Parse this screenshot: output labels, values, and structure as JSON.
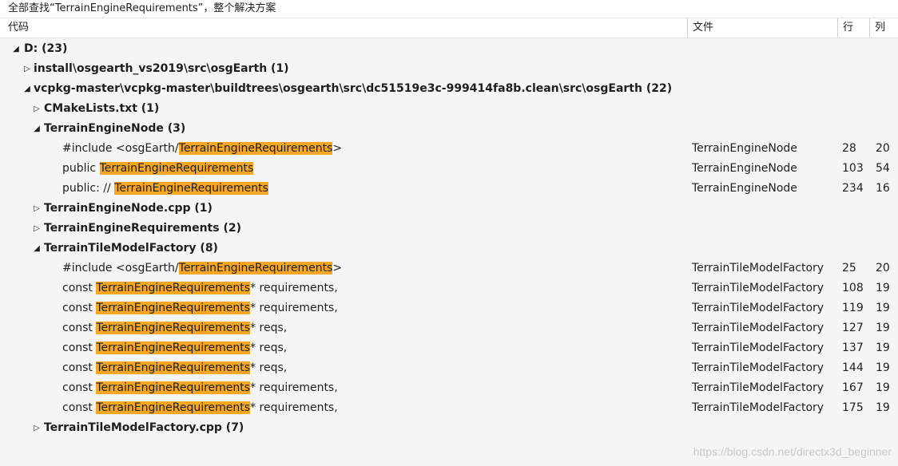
{
  "title": "全部查找“TerrainEngineRequirements”，整个解决方案",
  "columns": {
    "code": "代码",
    "file": "文件",
    "line": "行",
    "col": "列"
  },
  "tree": {
    "root": {
      "label": "D:",
      "count": "(23)"
    },
    "install": {
      "label": "install\\osgearth_vs2019\\src\\osgEarth",
      "count": "(1)"
    },
    "vcpkg": {
      "label": "vcpkg-master\\vcpkg-master\\buildtrees\\osgearth\\src\\dc51519e3c-999414fa8b.clean\\src\\osgEarth",
      "count": "(22)"
    },
    "cmake": {
      "label": "CMakeLists.txt",
      "count": "(1)"
    },
    "node": {
      "label": "TerrainEngineNode",
      "count": "(3)"
    },
    "node_results": [
      {
        "pre": "#include <osgEarth/",
        "hl": "TerrainEngineRequirements",
        "post": ">",
        "file": "TerrainEngineNode",
        "line": "28",
        "col": "20"
      },
      {
        "pre": "public ",
        "hl": "TerrainEngineRequirements",
        "post": "",
        "file": "TerrainEngineNode",
        "line": "103",
        "col": "54"
      },
      {
        "pre": "public: // ",
        "hl": "TerrainEngineRequirements",
        "post": "",
        "file": "TerrainEngineNode",
        "line": "234",
        "col": "16"
      }
    ],
    "nodecpp": {
      "label": "TerrainEngineNode.cpp",
      "count": "(1)"
    },
    "req": {
      "label": "TerrainEngineRequirements",
      "count": "(2)"
    },
    "tile": {
      "label": "TerrainTileModelFactory",
      "count": "(8)"
    },
    "tile_results": [
      {
        "pre": "#include <osgEarth/",
        "hl": "TerrainEngineRequirements",
        "post": ">",
        "file": "TerrainTileModelFactory",
        "line": "25",
        "col": "20"
      },
      {
        "pre": "const ",
        "hl": "TerrainEngineRequirements",
        "post": "* requirements,",
        "file": "TerrainTileModelFactory",
        "line": "108",
        "col": "19"
      },
      {
        "pre": "const ",
        "hl": "TerrainEngineRequirements",
        "post": "* requirements,",
        "file": "TerrainTileModelFactory",
        "line": "119",
        "col": "19"
      },
      {
        "pre": "const ",
        "hl": "TerrainEngineRequirements",
        "post": "* reqs,",
        "file": "TerrainTileModelFactory",
        "line": "127",
        "col": "19"
      },
      {
        "pre": "const ",
        "hl": "TerrainEngineRequirements",
        "post": "* reqs,",
        "file": "TerrainTileModelFactory",
        "line": "137",
        "col": "19"
      },
      {
        "pre": "const ",
        "hl": "TerrainEngineRequirements",
        "post": "* reqs,",
        "file": "TerrainTileModelFactory",
        "line": "144",
        "col": "19"
      },
      {
        "pre": "const ",
        "hl": "TerrainEngineRequirements",
        "post": "* requirements,",
        "file": "TerrainTileModelFactory",
        "line": "167",
        "col": "19"
      },
      {
        "pre": "const ",
        "hl": "TerrainEngineRequirements",
        "post": "* requirements,",
        "file": "TerrainTileModelFactory",
        "line": "175",
        "col": "19"
      }
    ],
    "tilecpp": {
      "label": "TerrainTileModelFactory.cpp",
      "count": "(7)"
    }
  },
  "watermark": "https://blog.csdn.net/directx3d_beginner"
}
